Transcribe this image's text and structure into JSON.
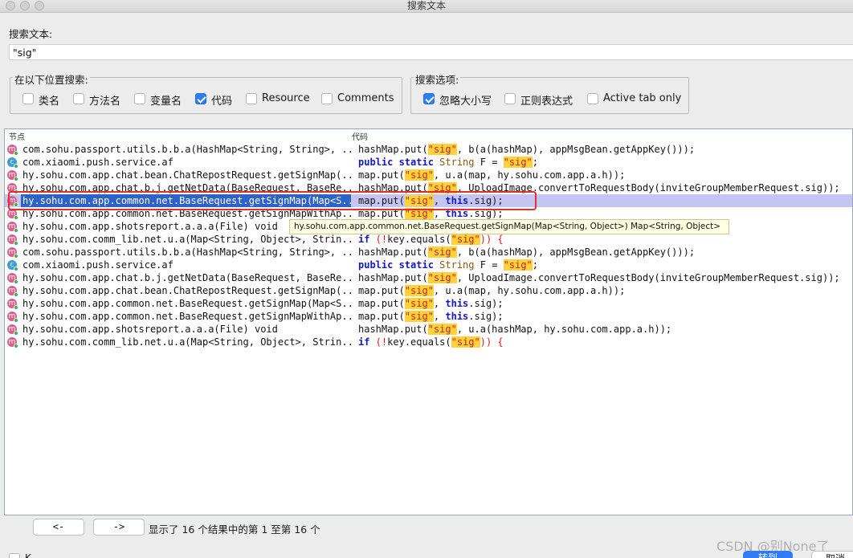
{
  "window": {
    "title": "搜索文本"
  },
  "search": {
    "label": "搜索文本:",
    "value": "\"sig\""
  },
  "location_group": {
    "title": "在以下位置搜索:",
    "options": [
      {
        "label": "类名",
        "checked": false
      },
      {
        "label": "方法名",
        "checked": false
      },
      {
        "label": "变量名",
        "checked": false
      },
      {
        "label": "代码",
        "checked": true
      },
      {
        "label": "Resource",
        "checked": false
      },
      {
        "label": "Comments",
        "checked": false
      }
    ]
  },
  "options_group": {
    "title": "搜索选项:",
    "options": [
      {
        "label": "忽略大小写",
        "checked": true
      },
      {
        "label": "正则表达式",
        "checked": false
      },
      {
        "label": "Active tab only",
        "checked": false
      }
    ]
  },
  "table": {
    "headers": {
      "node": "节点",
      "code": "代码"
    },
    "selected_index": 4,
    "rows": [
      {
        "icon": "m",
        "node": "com.sohu.passport.utils.b.b.a(HashMap<String, String>, ...",
        "code": [
          [
            "t",
            "hashMap.put("
          ],
          [
            "h",
            "\"sig\""
          ],
          [
            "t",
            ", b(a(hashMap), appMsgBean.getAppKey()));"
          ]
        ]
      },
      {
        "icon": "c",
        "node": "com.xiaomi.push.service.af",
        "code": [
          [
            "k",
            "public static "
          ],
          [
            "y",
            "String"
          ],
          [
            "t",
            " F = "
          ],
          [
            "h",
            "\"sig\""
          ],
          [
            "t",
            ";"
          ]
        ]
      },
      {
        "icon": "m",
        "node": "hy.sohu.com.app.chat.bean.ChatRepostRequest.getSignMap(...",
        "code": [
          [
            "t",
            "map.put("
          ],
          [
            "h",
            "\"sig\""
          ],
          [
            "t",
            ", u.a(map, hy.sohu.com.app.a.h));"
          ]
        ]
      },
      {
        "icon": "m",
        "node": "hy.sohu.com.app.chat.b.j.getNetData(BaseRequest, BaseRe...",
        "code": [
          [
            "t",
            "hashMap.put("
          ],
          [
            "h",
            "\"sig\""
          ],
          [
            "t",
            ", UploadImage.convertToRequestBody(inviteGroupMemberRequest.sig));"
          ]
        ]
      },
      {
        "icon": "m",
        "node": "hy.sohu.com.app.common.net.BaseRequest.getSignMap(Map<S...",
        "code": [
          [
            "t",
            "map.put("
          ],
          [
            "h",
            "\"sig\""
          ],
          [
            "t",
            ", "
          ],
          [
            "k",
            "this"
          ],
          [
            "t",
            ".sig);"
          ]
        ]
      },
      {
        "icon": "m",
        "node": "hy.sohu.com.app.common.net.BaseRequest.getSignMapWithAp...",
        "code": [
          [
            "t",
            "map.put("
          ],
          [
            "h",
            "\"sig\""
          ],
          [
            "t",
            ", "
          ],
          [
            "k",
            "this"
          ],
          [
            "t",
            ".sig);"
          ]
        ]
      },
      {
        "icon": "m",
        "node": "hy.sohu.com.app.shotsreport.a.a.a(File) void",
        "code": [
          [
            "t",
            ""
          ]
        ]
      },
      {
        "icon": "m",
        "node": "hy.sohu.com.comm_lib.net.u.a(Map<String, Object>, Strin...",
        "code": [
          [
            "k",
            "if"
          ],
          [
            "r",
            " (!"
          ],
          [
            "t",
            "key.equals("
          ],
          [
            "h",
            "\"sig\""
          ],
          [
            "r",
            ")) {"
          ]
        ]
      },
      {
        "icon": "m",
        "node": "com.sohu.passport.utils.b.b.a(HashMap<String, String>, ...",
        "code": [
          [
            "t",
            "hashMap.put("
          ],
          [
            "h",
            "\"sig\""
          ],
          [
            "t",
            ", b(a(hashMap), appMsgBean.getAppKey()));"
          ]
        ]
      },
      {
        "icon": "c",
        "node": "com.xiaomi.push.service.af",
        "code": [
          [
            "k",
            "public static "
          ],
          [
            "y",
            "String"
          ],
          [
            "t",
            " F = "
          ],
          [
            "h",
            "\"sig\""
          ],
          [
            "t",
            ";"
          ]
        ]
      },
      {
        "icon": "m",
        "node": "hy.sohu.com.app.chat.b.j.getNetData(BaseRequest, BaseRe...",
        "code": [
          [
            "t",
            "hashMap.put("
          ],
          [
            "h",
            "\"sig\""
          ],
          [
            "t",
            ", UploadImage.convertToRequestBody(inviteGroupMemberRequest.sig));"
          ]
        ]
      },
      {
        "icon": "m",
        "node": "hy.sohu.com.app.chat.bean.ChatRepostRequest.getSignMap(...",
        "code": [
          [
            "t",
            "map.put("
          ],
          [
            "h",
            "\"sig\""
          ],
          [
            "t",
            ", u.a(map, hy.sohu.com.app.a.h));"
          ]
        ]
      },
      {
        "icon": "m",
        "node": "hy.sohu.com.app.common.net.BaseRequest.getSignMap(Map<S...",
        "code": [
          [
            "t",
            "map.put("
          ],
          [
            "h",
            "\"sig\""
          ],
          [
            "t",
            ", "
          ],
          [
            "k",
            "this"
          ],
          [
            "t",
            ".sig);"
          ]
        ]
      },
      {
        "icon": "m",
        "node": "hy.sohu.com.app.common.net.BaseRequest.getSignMapWithAp...",
        "code": [
          [
            "t",
            "map.put("
          ],
          [
            "h",
            "\"sig\""
          ],
          [
            "t",
            ", "
          ],
          [
            "k",
            "this"
          ],
          [
            "t",
            ".sig);"
          ]
        ]
      },
      {
        "icon": "m",
        "node": "hy.sohu.com.app.shotsreport.a.a.a(File) void",
        "code": [
          [
            "t",
            "hashMap.put("
          ],
          [
            "h",
            "\"sig\""
          ],
          [
            "t",
            ", u.a(hashMap, hy.sohu.com.app.a.h));"
          ]
        ]
      },
      {
        "icon": "m",
        "node": "hy.sohu.com.comm_lib.net.u.a(Map<String, Object>, Strin...",
        "code": [
          [
            "k",
            "if"
          ],
          [
            "r",
            " (!"
          ],
          [
            "t",
            "key.equals("
          ],
          [
            "h",
            "\"sig\""
          ],
          [
            "r",
            ")) {"
          ]
        ]
      }
    ]
  },
  "tooltip": "hy.sohu.com.app.common.net.BaseRequest.getSignMap(Map<String, Object>) Map<String, Object>",
  "footer": {
    "prev": "<-",
    "next": "->",
    "status": "显示了 16 个结果中的第 1 至第 16 个",
    "goto": "转到",
    "cancel": "取消",
    "partial_checkbox_label": "K"
  },
  "watermark": "CSDN @别None了",
  "colors": {
    "accent": "#2f7cf6",
    "selection_row": "#c5c5f3",
    "selection_node": "#2d62c9",
    "highlight": "#ffd23a",
    "highlight_text": "#d31b1b",
    "keyword": "#1018c8"
  }
}
